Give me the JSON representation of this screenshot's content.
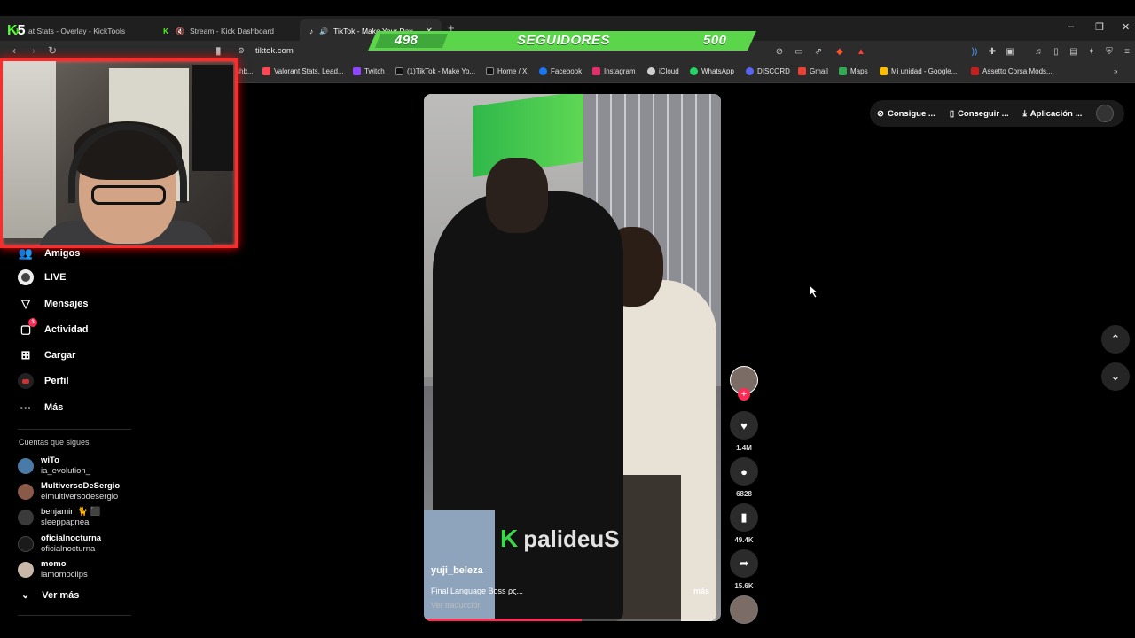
{
  "browser": {
    "tabs": [
      {
        "label": "at Stats - Overlay - KickTools",
        "active": false
      },
      {
        "label": "Stream - Kick Dashboard",
        "active": false
      },
      {
        "label": "TikTok - Make Your Day",
        "active": true
      }
    ],
    "new_tab": "+",
    "url": "tiktok.com",
    "window_controls": {
      "minimize": "–",
      "restore": "❐",
      "close": "✕"
    }
  },
  "bookmarks": [
    {
      "label": "shb...",
      "color": "#6b6b6b"
    },
    {
      "label": "Valorant Stats, Lead...",
      "color": "#ff4655"
    },
    {
      "label": "Twitch",
      "color": "#9146ff"
    },
    {
      "label": "(1)TikTok - Make Yo...",
      "color": "#111111"
    },
    {
      "label": "Home / X",
      "color": "#111111"
    },
    {
      "label": "Facebook",
      "color": "#1877f2"
    },
    {
      "label": "Instagram",
      "color": "#e1306c"
    },
    {
      "label": "iCloud",
      "color": "#d0d0d0"
    },
    {
      "label": "WhatsApp",
      "color": "#25d366"
    },
    {
      "label": "DISCORD",
      "color": "#5865f2"
    },
    {
      "label": "Gmail",
      "color": "#ea4335"
    },
    {
      "label": "Maps",
      "color": "#34a853"
    },
    {
      "label": "Mi unidad - Google...",
      "color": "#fbbc04"
    },
    {
      "label": "Assetto Corsa Mods...",
      "color": "#c41e1e"
    }
  ],
  "overlay": {
    "followers_current": "498",
    "followers_label": "SEGUIDORES",
    "followers_goal": "500",
    "bar_color": "#5bd64a",
    "logo_text": "K",
    "logo_num": "5"
  },
  "nav": {
    "items": [
      {
        "label": "Amigos",
        "icon": "friends-icon"
      },
      {
        "label": "LIVE",
        "icon": "live-icon"
      },
      {
        "label": "Mensajes",
        "icon": "messages-icon"
      },
      {
        "label": "Actividad",
        "icon": "activity-icon",
        "badge": "3"
      },
      {
        "label": "Cargar",
        "icon": "upload-icon"
      },
      {
        "label": "Perfil",
        "icon": "profile-icon"
      },
      {
        "label": "Más",
        "icon": "more-icon"
      }
    ],
    "following_title": "Cuentas que sigues",
    "following": [
      {
        "name": "wiTo",
        "handle": "ia_evolution_"
      },
      {
        "name": "MultiversoDeSergio",
        "handle": "elmultiversodesergio"
      },
      {
        "name": "benjamin 🐈 ⬛",
        "handle": "sleeppapnea"
      },
      {
        "name": "oficialnocturna",
        "handle": "oficialnocturna"
      },
      {
        "name": "momo",
        "handle": "lamomoclips"
      }
    ],
    "see_more": "Ver más"
  },
  "video": {
    "username": "yuji_beleza",
    "description": "Final Language Boss ρς...",
    "more": "más",
    "translate": "Ver traducción",
    "watermark": "palideuS",
    "progress": 0.53
  },
  "actions": {
    "likes": "1.4M",
    "comments": "6828",
    "saves": "49.4K",
    "shares": "15.6K"
  },
  "topbar": {
    "btn1": "Consigue ...",
    "btn2": "Conseguir ...",
    "btn3": "Aplicación ..."
  }
}
